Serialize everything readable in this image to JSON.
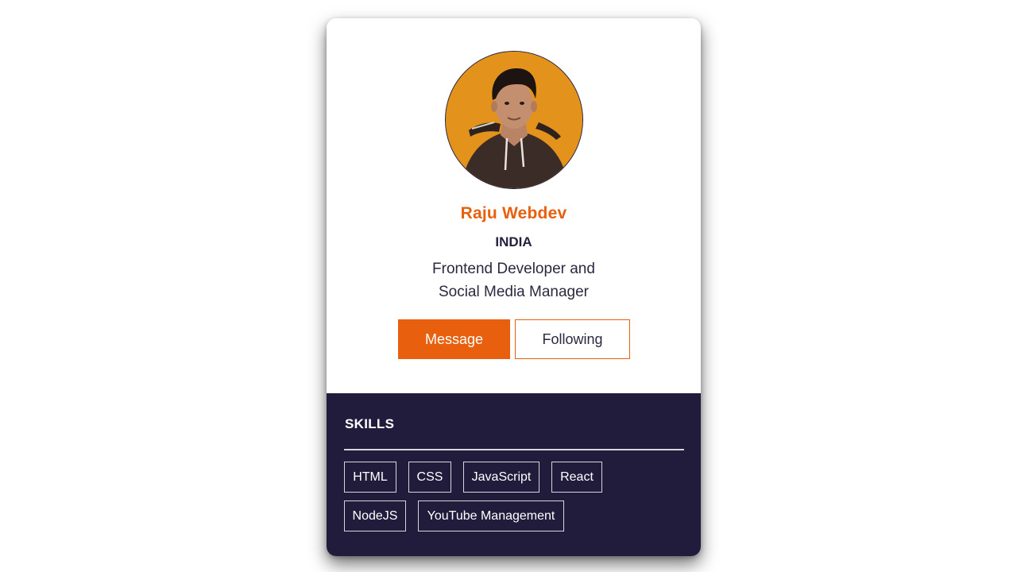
{
  "profile": {
    "name": "Raju Webdev",
    "country": "INDIA",
    "bio": "Frontend Developer and Social Media Manager",
    "avatar_icon": "profile-photo",
    "accent_color": "#e8600d",
    "dark_color": "#221c3c"
  },
  "actions": {
    "message_label": "Message",
    "following_label": "Following"
  },
  "skills": {
    "title": "SKILLS",
    "items": [
      "HTML",
      "CSS",
      "JavaScript",
      "React",
      "NodeJS",
      "YouTube Management"
    ]
  }
}
